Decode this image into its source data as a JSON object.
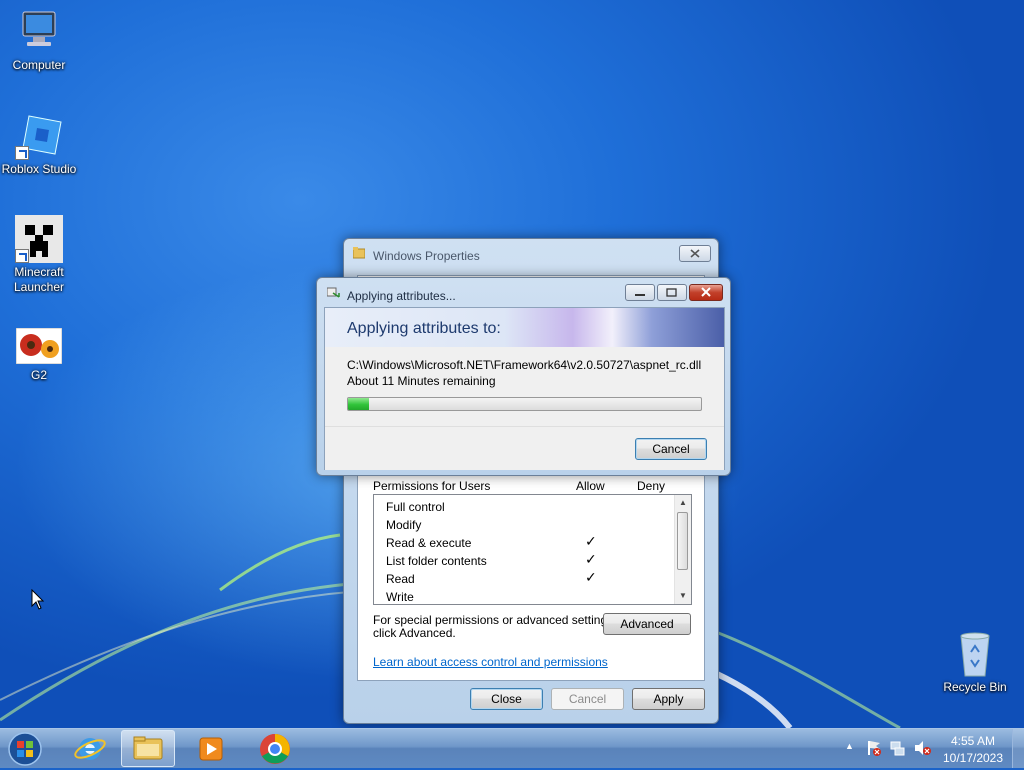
{
  "desktop": {
    "icons": {
      "computer": "Computer",
      "roblox": "Roblox Studio",
      "minecraft_line1": "Minecraft",
      "minecraft_line2": "Launcher",
      "g2": "G2",
      "recycle": "Recycle Bin"
    }
  },
  "properties_window": {
    "title": "Windows Properties",
    "permissions_header": "Permissions for Users",
    "allow_col": "Allow",
    "deny_col": "Deny",
    "permissions": [
      {
        "name": "Full control",
        "allow": false
      },
      {
        "name": "Modify",
        "allow": false
      },
      {
        "name": "Read & execute",
        "allow": true
      },
      {
        "name": "List folder contents",
        "allow": true
      },
      {
        "name": "Read",
        "allow": true
      },
      {
        "name": "Write",
        "allow": false
      }
    ],
    "check_glyph": "✓",
    "special_line1": "For special permissions or advanced settings,",
    "special_line2": "click Advanced.",
    "advanced_button": "Advanced",
    "learn_link": "Learn about access control and permissions",
    "close_button": "Close",
    "cancel_button": "Cancel",
    "apply_button": "Apply"
  },
  "progress_dialog": {
    "title": "Applying attributes...",
    "heading": "Applying attributes to:",
    "path": "C:\\Windows\\Microsoft.NET\\Framework64\\v2.0.50727\\aspnet_rc.dll",
    "remaining": "About 11 Minutes remaining",
    "progress_fraction": 0.06,
    "cancel_button": "Cancel"
  },
  "taskbar": {
    "pinned": [
      "start-orb",
      "internet-explorer",
      "file-explorer",
      "media-player",
      "chrome"
    ],
    "active": "file-explorer",
    "clock_time": "4:55 AM",
    "clock_date": "10/17/2023"
  },
  "colors": {
    "progress_fill": "#31c43a",
    "link": "#0066cc",
    "accent": "#3c7fb1"
  }
}
